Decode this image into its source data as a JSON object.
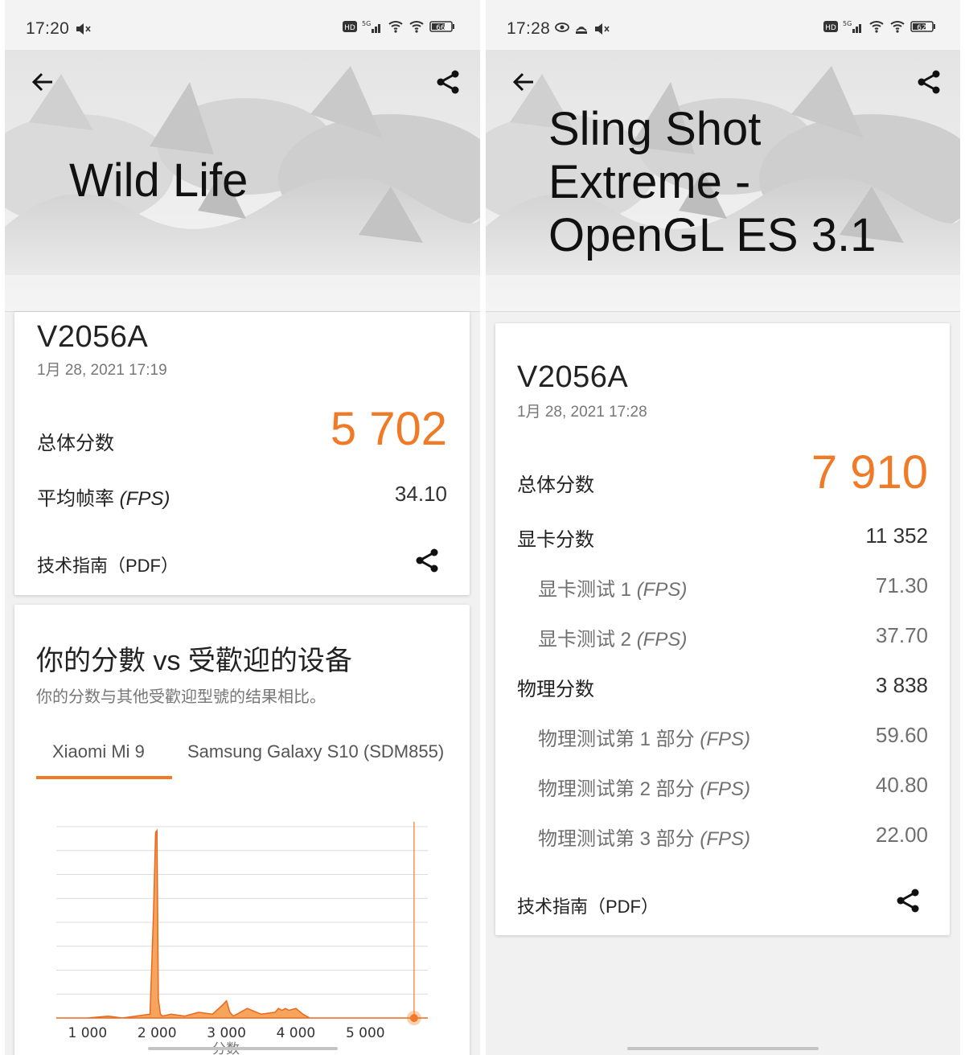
{
  "left": {
    "status": {
      "time": "17:20"
    },
    "hero_title": "Wild Life",
    "result": {
      "device": "V2056A",
      "date": "1月 28, 2021 17:19",
      "total_label": "总体分数",
      "total_value": "5 702",
      "fps_label_prefix": "平均帧率 ",
      "fps_label_unit": "(FPS)",
      "fps_value": "34.10",
      "guide_label": "技术指南（PDF）"
    },
    "compare": {
      "title": "你的分數 vs 受歡迎的设备",
      "subtitle": "你的分数与其他受歡迎型號的结果相比。",
      "tabs": [
        {
          "label": "Xiaomi Mi 9"
        },
        {
          "label": "Samsung Galaxy S10 (SDM855)"
        }
      ],
      "active_tab": 0
    }
  },
  "right": {
    "status": {
      "time": "17:28"
    },
    "hero_title_lines": [
      "Sling Shot",
      "Extreme -",
      "OpenGL ES 3.1"
    ],
    "result": {
      "device": "V2056A",
      "date": "1月 28, 2021 17:28",
      "total_label": "总体分数",
      "total_value": "7 910",
      "graphics_label": "显卡分数",
      "graphics_value": "11 352",
      "gt1_label": "显卡测试 1 ",
      "gt1_value": "71.30",
      "gt2_label": "显卡测试 2 ",
      "gt2_value": "37.70",
      "physics_label": "物理分数",
      "physics_value": "3 838",
      "pt1_label": "物理测试第 1 部分 ",
      "pt1_value": "59.60",
      "pt2_label": "物理测试第 2 部分 ",
      "pt2_value": "40.80",
      "pt3_label": "物理测试第 3 部分 ",
      "pt3_value": "22.00",
      "fps_unit": "(FPS)",
      "guide_label": "技术指南（PDF）"
    }
  },
  "colors": {
    "accent": "#f07a26",
    "bar_fill": "#f7a45c",
    "bar_stroke": "#e8691e"
  },
  "chart_data": {
    "type": "area",
    "xlabel": "分数",
    "x_ticks": [
      "1 000",
      "2 000",
      "3 000",
      "4 000",
      "5 000"
    ],
    "xlim": [
      550,
      5900
    ],
    "ylim": [
      0,
      1
    ],
    "grid": true,
    "your_score": 5702,
    "x": [
      550,
      1000,
      1300,
      1500,
      1700,
      1900,
      1950,
      1980,
      2000,
      2020,
      2050,
      2080,
      2200,
      2400,
      2600,
      2800,
      2950,
      3000,
      3050,
      3100,
      3300,
      3500,
      3700,
      3750,
      3800,
      3850,
      3900,
      4000,
      4100,
      4200,
      5900
    ],
    "values": [
      0.0,
      0.0,
      0.01,
      0.0,
      0.01,
      0.02,
      0.55,
      0.97,
      0.98,
      0.1,
      0.02,
      0.01,
      0.02,
      0.01,
      0.03,
      0.02,
      0.07,
      0.09,
      0.03,
      0.01,
      0.05,
      0.02,
      0.03,
      0.05,
      0.04,
      0.05,
      0.04,
      0.05,
      0.02,
      0.0,
      0.0
    ]
  }
}
